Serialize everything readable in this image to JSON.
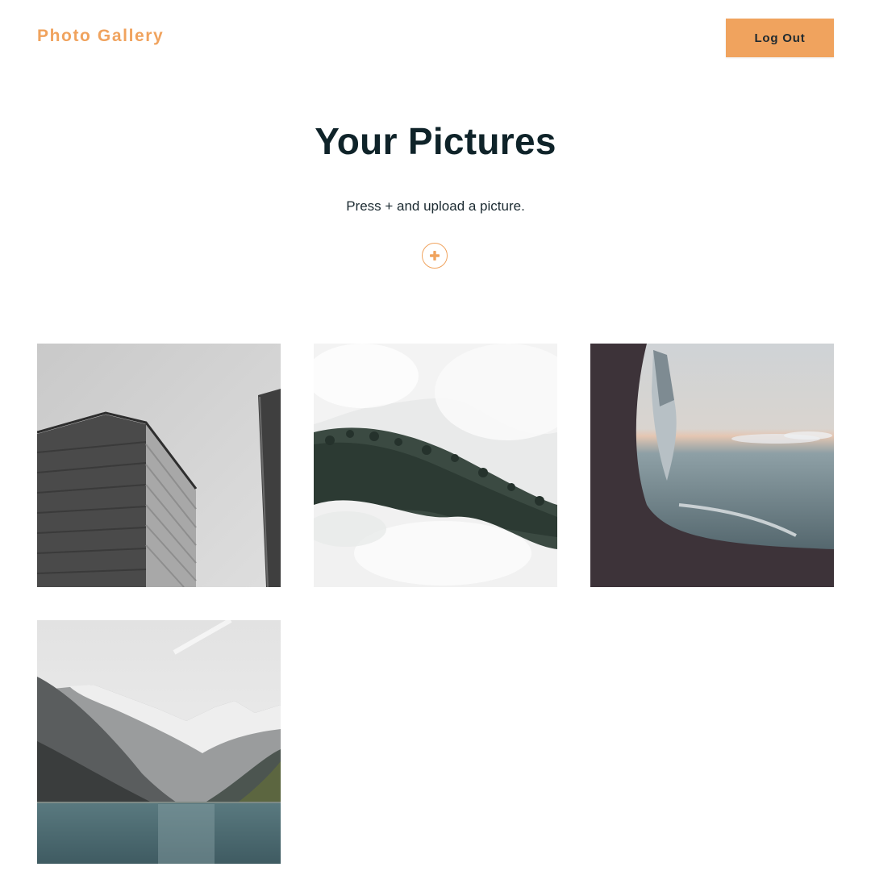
{
  "header": {
    "brand": "Photo Gallery",
    "logout_label": "Log Out"
  },
  "main": {
    "title": "Your Pictures",
    "instructions": "Press + and upload a picture.",
    "upload_icon": "plus-circle-icon"
  },
  "gallery": {
    "items": [
      {
        "subject": "building-photo"
      },
      {
        "subject": "foggy-forest-photo"
      },
      {
        "subject": "airplane-wing-photo"
      },
      {
        "subject": "mountain-lake-photo"
      }
    ]
  },
  "colors": {
    "accent": "#f0a35e",
    "title": "#0f2329",
    "background": "#ffffff"
  }
}
